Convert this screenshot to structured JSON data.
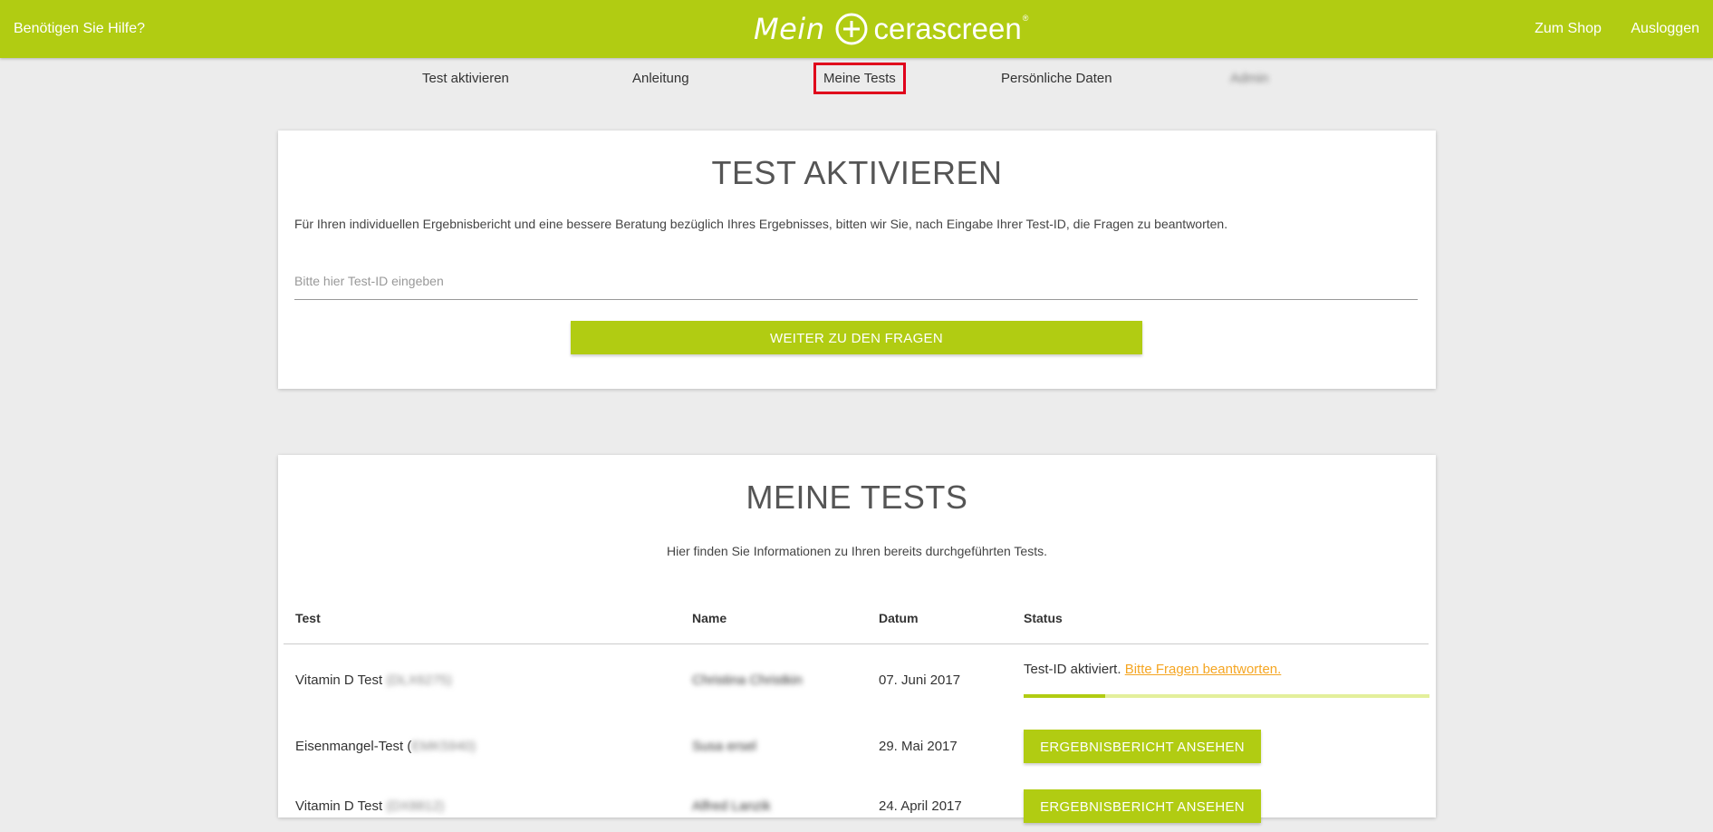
{
  "header": {
    "help": "Benötigen Sie Hilfe?",
    "logo_left": "Mein",
    "logo_brand": "cerascreen",
    "logo_reg": "®",
    "zum_shop": "Zum Shop",
    "ausloggen": "Ausloggen"
  },
  "nav": {
    "items": [
      "Test aktivieren",
      "Anleitung",
      "Meine Tests",
      "Persönliche Daten",
      "Admin"
    ],
    "active": "Meine Tests"
  },
  "activate": {
    "title": "TEST AKTIVIEREN",
    "description": "Für Ihren individuellen Ergebnisbericht und eine bessere Beratung bezüglich Ihres Ergebnisses, bitten wir Sie, nach Eingabe Ihrer Test-ID, die Fragen zu beantworten.",
    "input_placeholder": "Bitte hier Test-ID eingeben",
    "input_value": "",
    "button": "WEITER ZU DEN FRAGEN"
  },
  "tests": {
    "title": "MEINE TESTS",
    "subtitle": "Hier finden Sie Informationen zu Ihren bereits durchgeführten Tests.",
    "columns": [
      "Test",
      "Name",
      "Datum",
      "Status"
    ],
    "rows": [
      {
        "test": "Vitamin D Test",
        "test_id": "(DLX6275)",
        "name": "Christina Christkin",
        "date": "07. Juni 2017",
        "status_text": "Test-ID aktiviert.",
        "status_link": "Bitte Fragen beantworten.",
        "progress": 0.2
      },
      {
        "test": "Eisenmangel-Test (",
        "test_id": "EMK5940)",
        "name": "Susa ersel",
        "date": "29. Mai 2017",
        "button": "ERGEBNISBERICHT ANSEHEN"
      },
      {
        "test": "Vitamin D Test",
        "test_id": "(DX8812)",
        "name": "Alfred Lanzik",
        "date": "24. April 2017",
        "button": "ERGEBNISBERICHT ANSEHEN"
      }
    ]
  },
  "colors": {
    "brand_green": "#b1cc12",
    "link_orange": "#f5a623",
    "highlight_red": "#e0001b"
  }
}
